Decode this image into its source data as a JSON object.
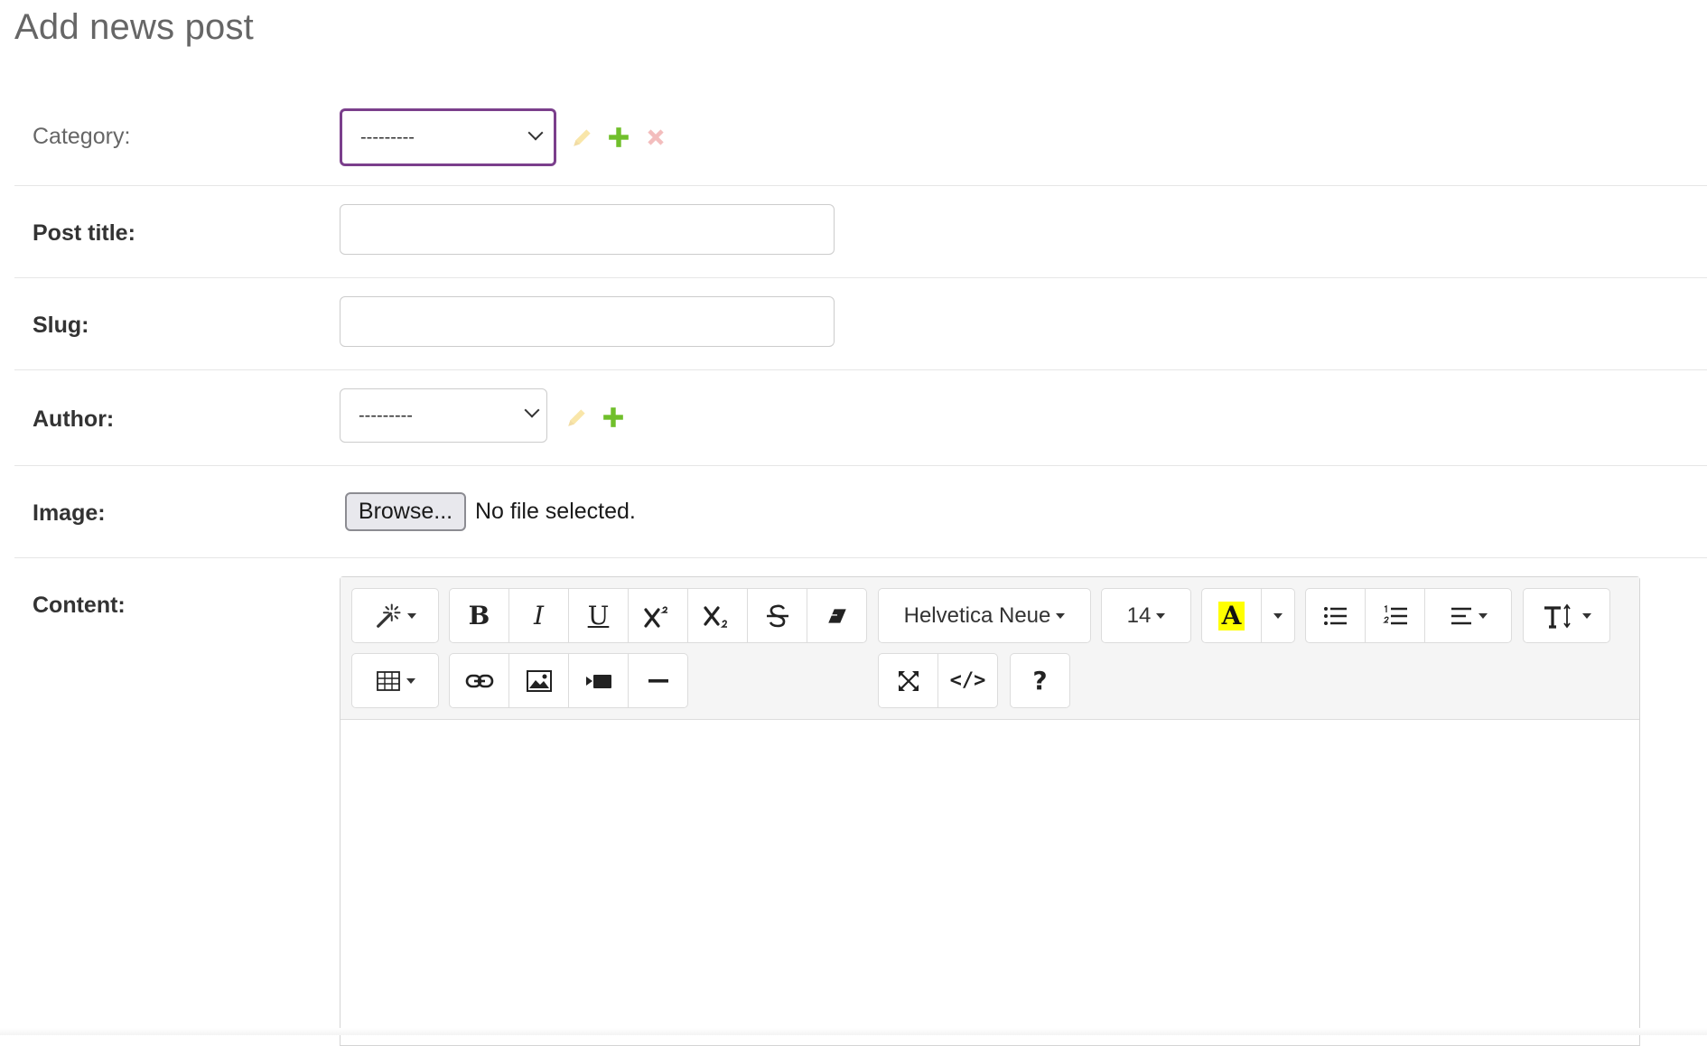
{
  "page": {
    "title": "Add news post"
  },
  "form": {
    "category": {
      "label": "Category:",
      "selected": "---------"
    },
    "post_title": {
      "label": "Post title:",
      "value": ""
    },
    "slug": {
      "label": "Slug:",
      "value": ""
    },
    "author": {
      "label": "Author:",
      "selected": "---------"
    },
    "image": {
      "label": "Image:",
      "browse_label": "Browse...",
      "status": "No file selected."
    },
    "content": {
      "label": "Content:"
    }
  },
  "editor": {
    "font_name": "Helvetica Neue",
    "font_size": "14",
    "help_label": "?",
    "code_label": "</>",
    "highlight_color": "#ffff00"
  },
  "icons": {
    "edit": "pencil-icon",
    "add": "plus-icon",
    "delete": "x-icon"
  },
  "colors": {
    "focus_border": "#7b3f8c",
    "add_green": "#70bf2b",
    "edit_yellow": "#efb80b",
    "delete_red": "#dd4646"
  }
}
